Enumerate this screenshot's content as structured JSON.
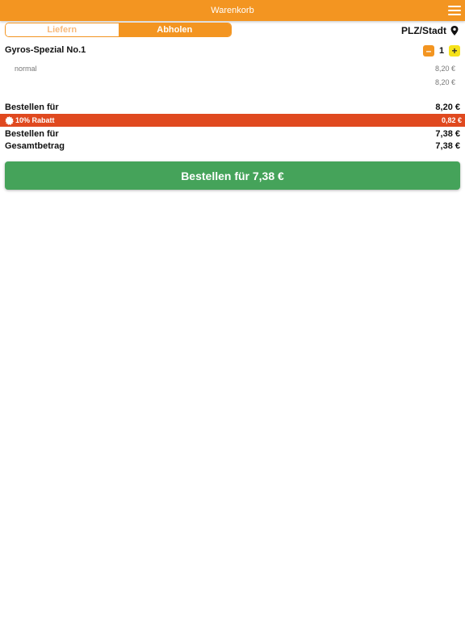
{
  "header": {
    "title": "Warenkorb",
    "menu_icon": "hamburger-menu-icon"
  },
  "mode_toggle": {
    "options": [
      {
        "label": "Liefern",
        "active": false
      },
      {
        "label": "Abholen",
        "active": true
      }
    ]
  },
  "location": {
    "label": "PLZ/Stadt",
    "icon": "map-pin-icon"
  },
  "cart": {
    "items": [
      {
        "name": "Gyros-Spezial No.1",
        "quantity": "1",
        "minus_label": "–",
        "plus_label": "+",
        "variant": "normal",
        "variant_price": "8,20 €",
        "line_total": "8,20 €"
      }
    ]
  },
  "summary": {
    "subtotal": {
      "label": "Bestellen für",
      "value": "8,20 €"
    },
    "discount": {
      "label": "10% Rabatt",
      "value": "0,82 €",
      "icon": "discount-badge-icon"
    },
    "after_discount": {
      "label": "Bestellen für",
      "value": "7,38 €"
    },
    "total": {
      "label": "Gesamtbetrag",
      "value": "7,38 €"
    }
  },
  "order_button": {
    "label": "Bestellen für 7,38 €"
  },
  "colors": {
    "header": "#f39521",
    "discount": "#e0491f",
    "order_button": "#45a35a",
    "plus_button": "#f6e21a"
  }
}
